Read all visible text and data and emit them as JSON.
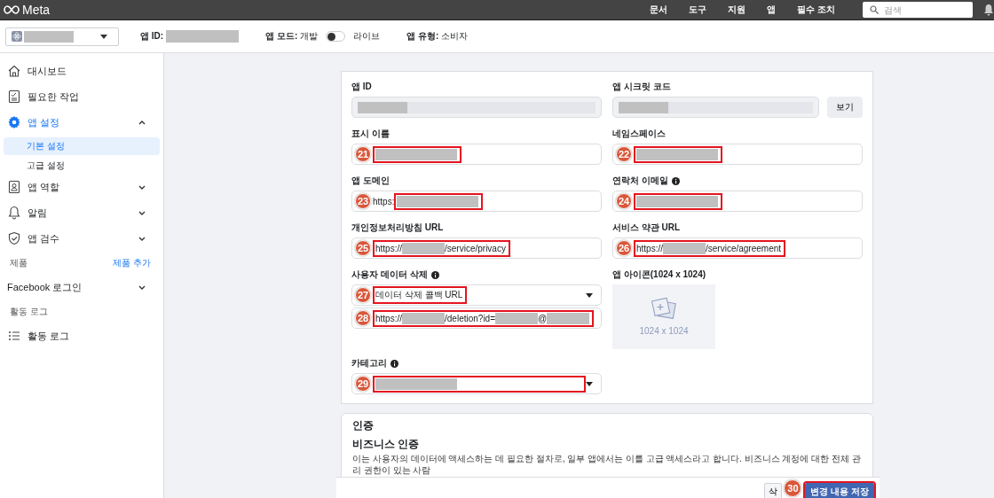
{
  "topbar": {
    "logo": "Meta",
    "nav": [
      "문서",
      "도구",
      "지원",
      "앱",
      "필수 조치"
    ],
    "search": {
      "placeholder": "검색"
    }
  },
  "app_bar": {
    "app_id_label": "앱 ID:",
    "mode_label": "앱 모드:",
    "mode_dev": "개발",
    "mode_toggle": {
      "on": false
    },
    "mode_live": "라이브",
    "type_label": "앱 유형:",
    "type_value": "소비자"
  },
  "sidebar": [
    {
      "kind": "item",
      "label": "대시보드",
      "selected": false
    },
    {
      "kind": "item",
      "label": "필요한 작업",
      "selected": false
    },
    {
      "kind": "item",
      "label": "앱 설정",
      "selected": true,
      "expanded": true,
      "children": [
        {
          "label": "기본 설정",
          "selected": true
        },
        {
          "label": "고급 설정",
          "selected": false
        }
      ]
    },
    {
      "kind": "item",
      "label": "앱 역할",
      "selected": false,
      "expanded": false
    },
    {
      "kind": "item",
      "label": "알림",
      "selected": false,
      "expanded": false
    },
    {
      "kind": "item",
      "label": "앱 검수",
      "selected": false,
      "expanded": false
    },
    {
      "kind": "section",
      "label": "제품",
      "action": "제품 추가"
    },
    {
      "kind": "item",
      "label": "Facebook 로그인",
      "selected": false,
      "expanded": false
    },
    {
      "kind": "section",
      "label": "활동 로그"
    },
    {
      "kind": "item",
      "label": "활동 로그",
      "selected": false
    }
  ],
  "settings_card": {
    "rows": [
      {
        "left": {
          "label": "앱 ID",
          "controls": [
            {
              "kind": "readonly",
              "parts": [
                {
                  "kind": "redacted"
                }
              ]
            }
          ]
        },
        "right": {
          "label": "앱 시크릿 코드",
          "button": "보기",
          "controls": [
            {
              "kind": "readonly",
              "parts": [
                {
                  "kind": "redacted"
                }
              ]
            }
          ]
        }
      },
      {
        "left": {
          "label": "표시 이름",
          "controls": [
            {
              "kind": "input",
              "annotation": "21",
              "parts": [
                {
                  "kind": "redacted"
                }
              ]
            }
          ]
        },
        "right": {
          "label": "네임스페이스",
          "controls": [
            {
              "kind": "input",
              "annotation": "22",
              "parts": [
                {
                  "kind": "redacted"
                }
              ]
            }
          ]
        }
      },
      {
        "left": {
          "label": "앱 도메인",
          "controls": [
            {
              "kind": "input",
              "prefix": "https:",
              "annotation": "23",
              "parts": [
                {
                  "kind": "redacted"
                }
              ]
            }
          ]
        },
        "right": {
          "label": "연락처 이메일",
          "info": true,
          "controls": [
            {
              "kind": "input",
              "annotation": "24",
              "parts": [
                {
                  "kind": "redacted"
                }
              ]
            }
          ]
        }
      },
      {
        "left": {
          "label": "개인정보처리방침 URL",
          "controls": [
            {
              "kind": "input",
              "annotation": "25",
              "parts": [
                {
                  "kind": "text",
                  "text": "https://"
                },
                {
                  "kind": "redacted"
                },
                {
                  "kind": "text",
                  "text": "/service/privacy"
                }
              ]
            }
          ]
        },
        "right": {
          "label": "서비스 약관 URL",
          "controls": [
            {
              "kind": "input",
              "annotation": "26",
              "parts": [
                {
                  "kind": "text",
                  "text": "https://"
                },
                {
                  "kind": "redacted"
                },
                {
                  "kind": "text",
                  "text": "/service/agreement"
                }
              ]
            }
          ]
        }
      },
      {
        "left": {
          "label": "사용자 데이터 삭제",
          "info": true,
          "controls": [
            {
              "kind": "select",
              "annotation": "27",
              "parts": [
                {
                  "kind": "text",
                  "text": "데이터 삭제 콜백 URL"
                }
              ]
            },
            {
              "kind": "input",
              "annotation": "28",
              "parts": [
                {
                  "kind": "text",
                  "text": "https://"
                },
                {
                  "kind": "redacted"
                },
                {
                  "kind": "text",
                  "text": "/deletion?id="
                },
                {
                  "kind": "redacted"
                },
                {
                  "kind": "text",
                  "text": "@"
                },
                {
                  "kind": "redacted"
                }
              ]
            }
          ]
        },
        "right": {
          "label": "앱 아이콘(1024 x 1024)",
          "kind": "icon_upload",
          "caption": "1024 x 1024"
        }
      },
      {
        "left": {
          "label": "카테고리",
          "info": true,
          "controls": [
            {
              "kind": "select",
              "annotation": "29",
              "full": true,
              "parts": [
                {
                  "kind": "redacted"
                }
              ]
            }
          ]
        }
      }
    ]
  },
  "verification_card": {
    "title": "인증",
    "subtitle": "비즈니스 인증",
    "text": "이는 사용자의 데이터에 액세스하는 데 필요한 절차로, 일부 앱에서는 이를 고급 액세스라고 합니다. 비즈니스 계정에 대한 전체 관리 권한이 있는 사람"
  },
  "footer": {
    "buttons": [
      {
        "kind": "secondary",
        "label": "삭"
      },
      {
        "kind": "primary",
        "label": "변경 내용 저장",
        "annotation": "30"
      }
    ]
  }
}
